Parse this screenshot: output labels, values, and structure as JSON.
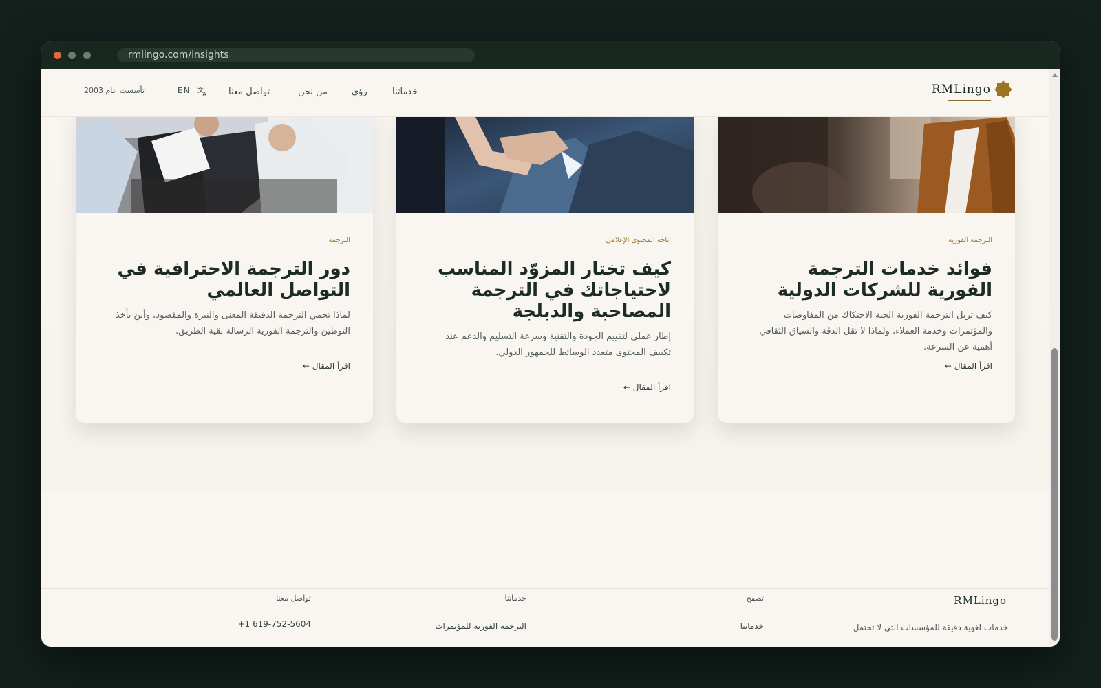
{
  "browser": {
    "url": "rmlingo.com/insights"
  },
  "nav": {
    "logo_text": "RMLingo",
    "links": [
      "خدماتنا",
      "رؤى",
      "من نحن",
      "تواصل معنا"
    ],
    "lang_label": "EN",
    "lang_icon": "translate-icon",
    "founded": "تأسست عام 2003"
  },
  "cards": [
    {
      "category": "الترجمة الفورية",
      "title": "فوائد خدمات الترجمة الفورية للشركات الدولية",
      "excerpt": "كيف تزيل الترجمة الفورية الحية الاحتكاك من المفاوضات والمؤتمرات وخدمة العملاء، ولماذا لا تقل الدقة والسياق الثقافي أهمية عن السرعة.",
      "link": "اقرأ المقال ←"
    },
    {
      "category": "إتاحة المحتوى الإعلامي",
      "title": "كيف تختار المزوّد المناسب لاحتياجاتك في الترجمة المصاحبة والدبلجة",
      "excerpt": "إطار عملي لتقييم الجودة والتقنية وسرعة التسليم والدعم عند تكييف المحتوى متعدد الوسائط للجمهور الدولي.",
      "link": "اقرأ المقال ←"
    },
    {
      "category": "الترجمة",
      "title": "دور الترجمة الاحترافية في التواصل العالمي",
      "excerpt": "لماذا تحمي الترجمة الدقيقة المعنى والنبرة والمقصود، وأين يأخذ التوطين والترجمة الفورية الرسالة بقية الطريق.",
      "link": "اقرأ المقال ←"
    }
  ],
  "footer": {
    "logo_text": "RMLingo",
    "description": "خدمات لغوية دقيقة للمؤسسات التي لا تحتمل",
    "columns": [
      {
        "heading": "تصفح",
        "first_item": "خدماتنا"
      },
      {
        "heading": "خدماتنا",
        "first_item": "الترجمة الفورية للمؤتمرات"
      },
      {
        "heading": "تواصل معنا",
        "first_item": "+1 619-752-5604"
      }
    ]
  },
  "colors": {
    "page_bg": "#f9f6f1",
    "heading": "#1d2b25",
    "accent_gold": "#a07a34",
    "logo_star": "#9b7424",
    "frame": "#13201c"
  }
}
